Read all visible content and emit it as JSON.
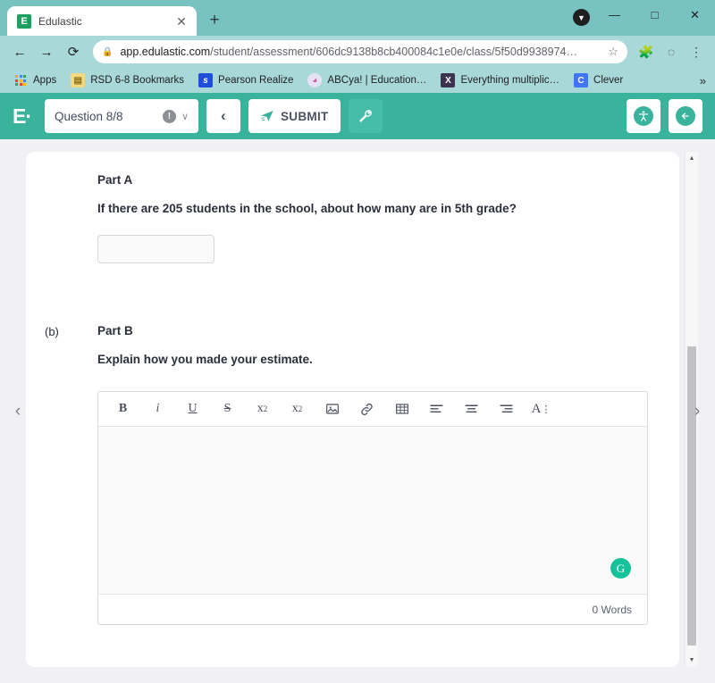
{
  "browser": {
    "tab": {
      "title": "Edulastic",
      "favicon": "edulastic-icon",
      "close": "✕"
    },
    "new_tab": "+",
    "window": {
      "minimize": "—",
      "maximize": "□",
      "close": "✕",
      "download": "▼"
    },
    "nav": {
      "back": "←",
      "forward": "→",
      "reload": "⟳"
    },
    "omnibox": {
      "lock": "🔒",
      "url_domain": "app.edulastic.com",
      "url_path": "/student/assessment/606dc9138b8cb400084c1e0e/class/5f50d9938974…",
      "star": "☆"
    },
    "toolbar_icons": {
      "extensions": "🧩",
      "profile": "◌",
      "menu": "⋮"
    },
    "bookmarks": [
      {
        "label": "Apps",
        "icon": "apps-grid-icon"
      },
      {
        "label": "RSD 6-8 Bookmarks",
        "icon": "folder-icon",
        "glyph": "▤"
      },
      {
        "label": "Pearson Realize",
        "icon": "pearson-icon",
        "glyph": "s"
      },
      {
        "label": "ABCya! | Education…",
        "icon": "abcya-icon",
        "glyph": "◕"
      },
      {
        "label": "Everything multiplic…",
        "icon": "x-site-icon",
        "glyph": "X"
      },
      {
        "label": "Clever",
        "icon": "clever-icon",
        "glyph": "C"
      }
    ],
    "bookmarks_overflow": "»"
  },
  "app": {
    "logo": "E·",
    "question_selector": {
      "label": "Question 8/8",
      "info": "!",
      "chevron": "∨"
    },
    "prev_button": "‹",
    "submit_button": {
      "label": "SUBMIT",
      "icon": "paper-plane-icon"
    },
    "tools_button": {
      "icon": "wrench-icon",
      "glyph": "🔧"
    },
    "accessibility_button": {
      "icon": "accessibility-icon",
      "glyph": "๏"
    },
    "exit_button": {
      "icon": "exit-arrow-icon",
      "glyph": "←"
    }
  },
  "stage": {
    "prev_arrow": "‹",
    "next_arrow": "›",
    "scrollbar": {
      "up": "▲",
      "down": "▼"
    }
  },
  "question": {
    "part_a": {
      "heading": "Part A",
      "prompt": "If there are 205 students in the school, about how many are in 5th grade?",
      "answer_value": "",
      "answer_placeholder": ""
    },
    "part_b": {
      "letter": "(b)",
      "heading": "Part B",
      "prompt": "Explain how you made your estimate.",
      "editor": {
        "toolbar": [
          {
            "name": "bold-icon",
            "glyph": "B"
          },
          {
            "name": "italic-icon",
            "glyph": "i"
          },
          {
            "name": "underline-icon",
            "glyph": "U"
          },
          {
            "name": "strikethrough-icon",
            "glyph": "S"
          },
          {
            "name": "subscript-icon",
            "glyph": "x₂"
          },
          {
            "name": "superscript-icon",
            "glyph": "x²"
          },
          {
            "name": "image-icon",
            "glyph": "⛰"
          },
          {
            "name": "link-icon",
            "glyph": "⚭"
          },
          {
            "name": "table-icon",
            "glyph": "▦"
          },
          {
            "name": "align-left-icon",
            "glyph": "≡"
          },
          {
            "name": "align-center-icon",
            "glyph": "≡"
          },
          {
            "name": "align-right-icon",
            "glyph": "≡"
          },
          {
            "name": "font-options-icon",
            "glyph": "A⋮"
          }
        ],
        "content": "",
        "grammarly": "G",
        "word_count": "0 Words"
      }
    }
  },
  "colors": {
    "brand_green": "#3ab39d",
    "chrome_theme": "#a8d8d8",
    "tabstrip": "#78c2c2",
    "grammarly_green": "#15c39a",
    "page_bg": "#f1f1f5"
  }
}
